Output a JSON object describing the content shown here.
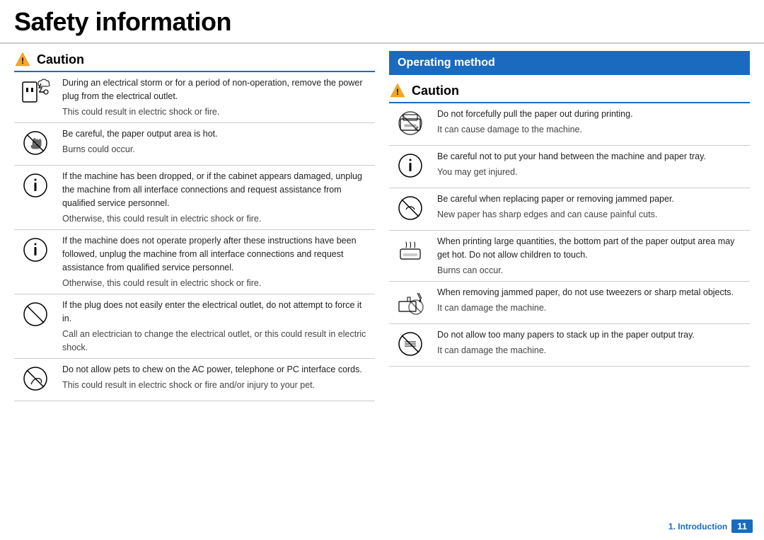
{
  "header": {
    "title": "Safety information"
  },
  "left": {
    "section_label": "Caution",
    "rows": [
      {
        "icon": "power-storm",
        "main": "During an electrical storm or for a period of non-operation, remove the power plug from the electrical outlet.",
        "secondary": "This could result in electric shock or fire."
      },
      {
        "icon": "hot-output",
        "main": "Be careful, the paper output area is hot.",
        "secondary": "Burns could occur."
      },
      {
        "icon": "drop-service",
        "main": "If the machine has been dropped, or if the cabinet appears damaged, unplug the machine from all interface connections and request assistance from qualified service personnel.",
        "secondary": "Otherwise, this could result in electric shock or fire."
      },
      {
        "icon": "not-operate",
        "main": "If the machine does not operate properly after these instructions have been followed, unplug the machine from all interface connections and request assistance from qualified service personnel.",
        "secondary": "Otherwise, this could result in electric shock or fire."
      },
      {
        "icon": "no-force-plug",
        "main": "If the plug does not easily enter the electrical outlet, do not attempt to force it in.",
        "secondary": "Call an electrician to change the electrical outlet, or this could result in electric shock."
      },
      {
        "icon": "no-pets",
        "main": "Do not allow pets to chew on the AC power, telephone or PC interface cords.",
        "secondary": "This could result in electric shock or fire and/or injury to your pet."
      }
    ]
  },
  "right": {
    "op_method_label": "Operating method",
    "section_label": "Caution",
    "rows": [
      {
        "icon": "no-pull-paper",
        "main": "Do not forcefully pull the paper out during printing.",
        "secondary": "It can cause damage to the machine."
      },
      {
        "icon": "hand-tray",
        "main": "Be careful not to put your hand between the machine and paper tray.",
        "secondary": "You may get injured."
      },
      {
        "icon": "no-jammed",
        "main": "Be careful when replacing paper or removing jammed paper.",
        "secondary": "New paper has sharp edges and can cause painful cuts."
      },
      {
        "icon": "hot-bottom",
        "main": "When printing large quantities, the bottom part of the paper output area may get hot. Do not allow children to touch.",
        "secondary": "Burns can occur."
      },
      {
        "icon": "no-tweezers",
        "main": "When removing jammed paper, do not use tweezers or sharp metal objects.",
        "secondary": "It can damage the machine."
      },
      {
        "icon": "no-stack",
        "main": "Do not allow too many papers to stack up in the paper output tray.",
        "secondary": "It can damage the machine."
      }
    ]
  },
  "footer": {
    "text": "1. Introduction",
    "page": "11"
  }
}
